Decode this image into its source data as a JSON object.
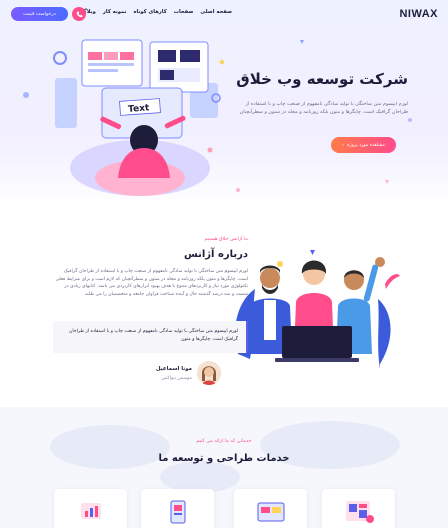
{
  "header": {
    "logo": "NIWAX",
    "nav_items": [
      "صفحه اصلی",
      "صفحات",
      "کارهای کوتاه",
      "نمونه کار",
      "وبلاگ"
    ],
    "request_button": "درخواست قیمت"
  },
  "hero": {
    "title": "شرکت توسعه وب خلاق",
    "description": "لورم ایپسوم متن ساختگی با تولید سادگی نامفهوم از صنعت چاپ و با استفاده از طراحان گرافیک است. چاپگرها و متون بلکه روزنامه و مجله در ستون و سطرآنچنان",
    "cta_button": "مشاهده مورد پروژه",
    "illustration_text": "Text"
  },
  "about": {
    "tag": "ما آژانس خلاق هستیم",
    "title": "درباره آژانس",
    "body": "لورم ایپسوم متن ساختگی با تولید سادگی نامفهوم از صنعت چاپ و با استفاده از طراحان گرافیک است. چاپگرها و متون بلکه روزنامه و مجله در ستون و سطرآنچنان که لازم است و برای شرایط فعلی تکنولوژی مورد نیاز و کاربردهای متنوع با هدف بهبود ابزارهای کاربردی می باشد. کتابهای زیادی در شصت و سه درصد گذشته حال و آینده شناخت فراوان جامعه و متخصصان را می طلبد.",
    "quote": "لورم ایپسوم متن ساختگی با تولید سادگی نامفهوم از صنعت چاپ و با استفاده از طراحان گرافیک است. چاپگرها و متون",
    "author_name": "مونا اسماعیل",
    "author_role": "موسس نیواکس"
  },
  "services": {
    "tag": "خدماتی که ما ارائه می کنیم",
    "title": "خدمات طراحی و توسعه ما"
  },
  "colors": {
    "accent_pink": "#ff4c8b",
    "accent_purple": "#5a5ee8",
    "dark_text": "#1d1d3b"
  }
}
